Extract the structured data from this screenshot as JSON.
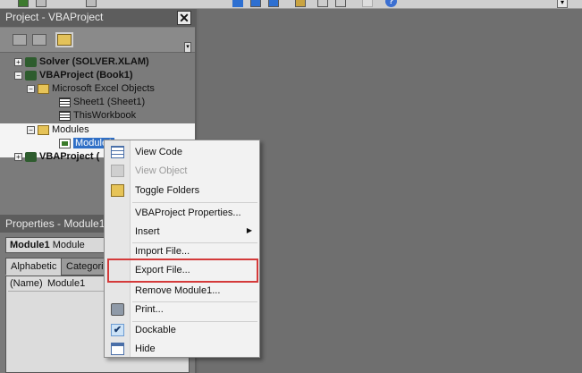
{
  "project_explorer": {
    "title": "Project - VBAProject",
    "close_label": "✕",
    "tree": [
      {
        "label": "Solver (SOLVER.XLAM)",
        "bold": true
      },
      {
        "label": "VBAProject (Book1)",
        "bold": true
      },
      {
        "label": "Microsoft Excel Objects",
        "bold": false
      },
      {
        "label": "Sheet1 (Sheet1)",
        "bold": false
      },
      {
        "label": "ThisWorkbook",
        "bold": false
      },
      {
        "label": "Modules",
        "bold": false
      },
      {
        "label": "Module1",
        "bold": false,
        "selected": true
      },
      {
        "label": "VBAProject (",
        "bold": true
      }
    ]
  },
  "properties": {
    "title": "Properties - Module1",
    "object_name": "Module1",
    "object_type": "Module",
    "tabs": [
      "Alphabetic",
      "Categoriz"
    ],
    "row_key": "(Name)",
    "row_value": "Module1"
  },
  "context_menu": {
    "items": [
      {
        "label": "View Code",
        "enabled": true
      },
      {
        "label": "View Object",
        "enabled": false
      },
      {
        "label": "Toggle Folders",
        "enabled": true
      },
      {
        "label": "VBAProject Properties...",
        "enabled": true
      },
      {
        "label": "Insert",
        "enabled": true,
        "submenu": true
      },
      {
        "label": "Import File...",
        "enabled": true
      },
      {
        "label": "Export File...",
        "enabled": true,
        "highlighted": true
      },
      {
        "label": "Remove Module1...",
        "enabled": true
      },
      {
        "label": "Print...",
        "enabled": true
      },
      {
        "label": "Dockable",
        "enabled": true,
        "checked": true
      },
      {
        "label": "Hide",
        "enabled": true
      }
    ],
    "highlight_color": "#d43a3a"
  },
  "icons": {
    "help": "?",
    "dropdown": "▾",
    "submenu_arrow": "▶",
    "check": "✔"
  }
}
